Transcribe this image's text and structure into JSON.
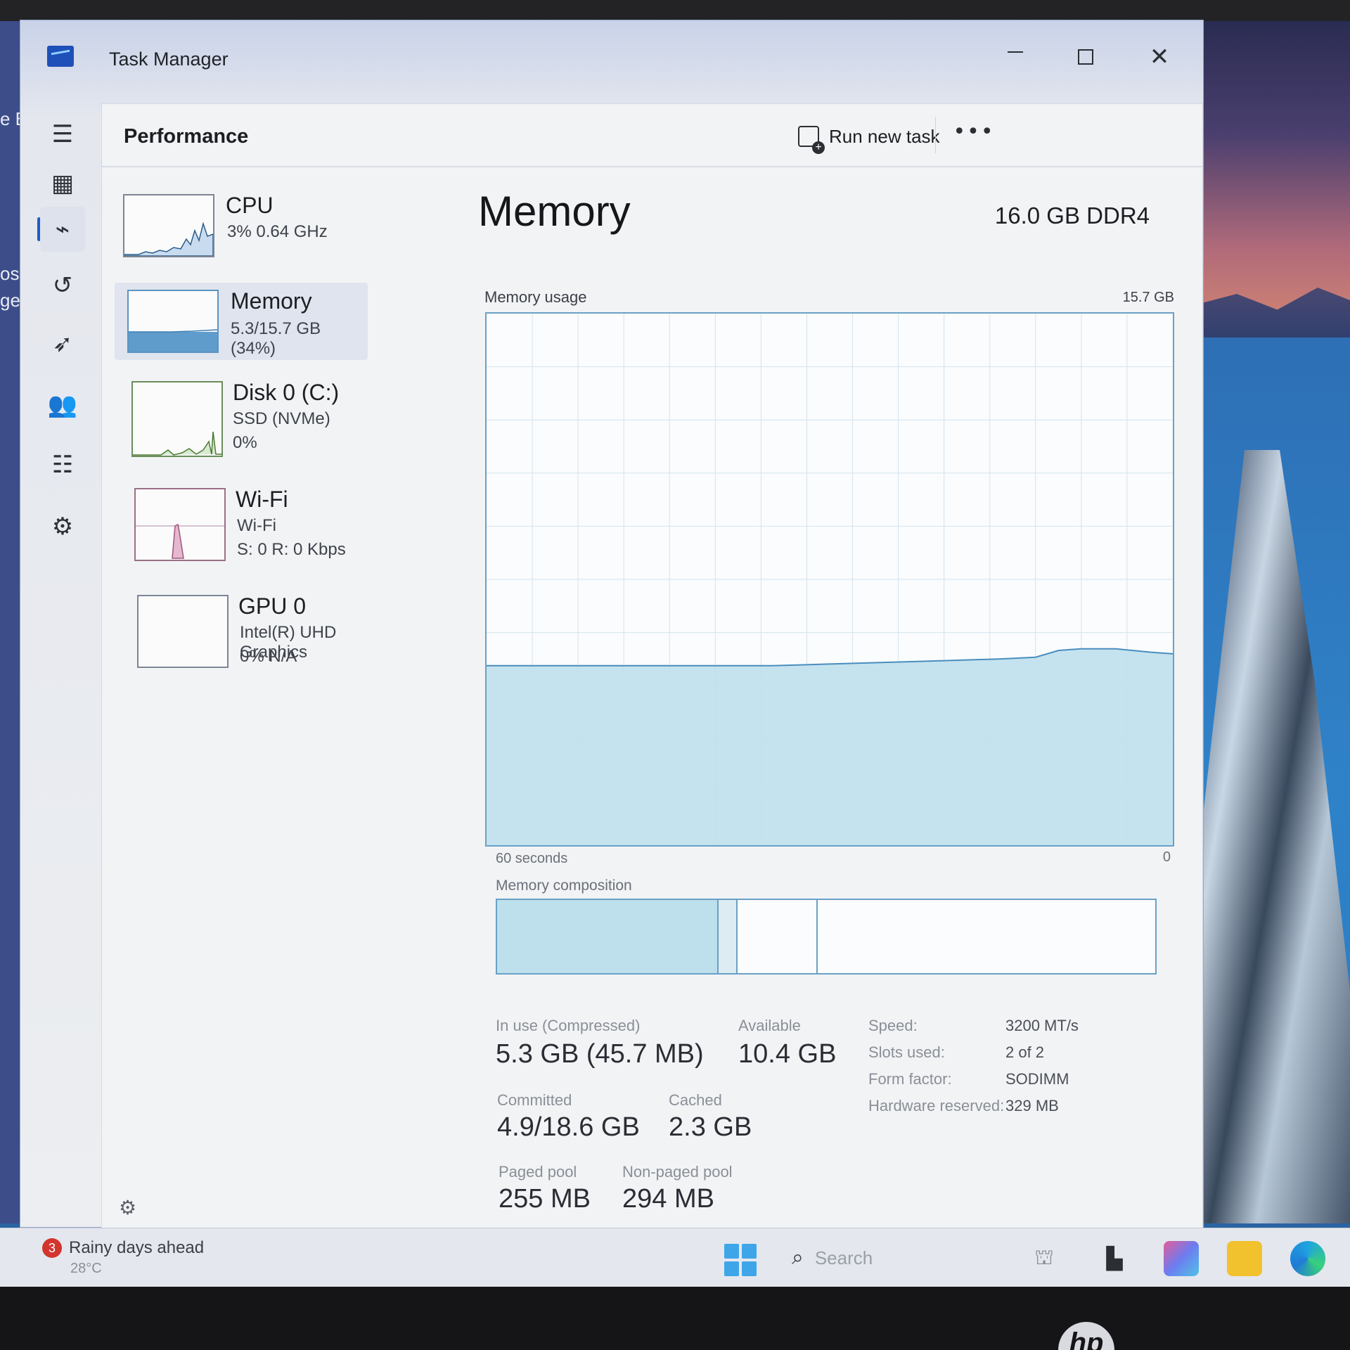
{
  "window": {
    "title": "Task Manager",
    "controls": {
      "minimize": "minimize",
      "maximize": "maximize",
      "close": "✕"
    }
  },
  "desktop": {
    "left_text_1": "e B",
    "left_text_2": "osof",
    "left_text_3": "ge"
  },
  "rail": {
    "items": [
      {
        "name": "menu-icon",
        "glyph": "☰"
      },
      {
        "name": "processes-icon",
        "glyph": "▦"
      },
      {
        "name": "performance-icon",
        "glyph": "⌁"
      },
      {
        "name": "app-history-icon",
        "glyph": "↺"
      },
      {
        "name": "startup-apps-icon",
        "glyph": "➶"
      },
      {
        "name": "users-icon",
        "glyph": "👥"
      },
      {
        "name": "details-icon",
        "glyph": "☷"
      },
      {
        "name": "services-icon",
        "glyph": "⚙"
      }
    ],
    "settings_glyph": "⚙"
  },
  "header": {
    "title": "Performance",
    "run_new_task": "Run new task",
    "more": "•••"
  },
  "sidebar": {
    "items": [
      {
        "name": "CPU",
        "line1": "3%  0.64 GHz",
        "line2": ""
      },
      {
        "name": "Memory",
        "line1": "5.3/15.7 GB (34%)",
        "line2": ""
      },
      {
        "name": "Disk 0 (C:)",
        "line1": "SSD (NVMe)",
        "line2": "0%"
      },
      {
        "name": "Wi-Fi",
        "line1": "Wi-Fi",
        "line2": "S: 0 R: 0 Kbps"
      },
      {
        "name": "GPU 0",
        "line1": "Intel(R) UHD Graphics",
        "line2": "0%  N/A"
      }
    ]
  },
  "memory": {
    "title": "Memory",
    "spec": "16.0 GB DDR4",
    "usage_label": "Memory usage",
    "usage_max": "15.7 GB",
    "axis_left": "60 seconds",
    "axis_right": "0",
    "composition_label": "Memory composition",
    "composition": {
      "in_use_fraction": 0.337,
      "modified_fraction": 0.028,
      "standby_fraction": 0.122
    },
    "stats": {
      "in_use_label": "In use (Compressed)",
      "in_use_value": "5.3 GB (45.7 MB)",
      "available_label": "Available",
      "available_value": "10.4 GB",
      "committed_label": "Committed",
      "committed_value": "4.9/18.6 GB",
      "cached_label": "Cached",
      "cached_value": "2.3 GB",
      "paged_label": "Paged pool",
      "paged_value": "255 MB",
      "nonpaged_label": "Non-paged pool",
      "nonpaged_value": "294 MB"
    },
    "specs": [
      {
        "label": "Speed:",
        "value": "3200 MT/s"
      },
      {
        "label": "Slots used:",
        "value": "2 of 2"
      },
      {
        "label": "Form factor:",
        "value": "SODIMM"
      },
      {
        "label": "Hardware reserved:",
        "value": "329 MB"
      }
    ]
  },
  "taskbar": {
    "weather_badge": "3",
    "weather_text": "Rainy days ahead",
    "weather_temp": "28°C",
    "search_placeholder": "Search"
  },
  "chart_data": {
    "type": "area",
    "title": "Memory usage",
    "xlabel": "60 seconds",
    "ylabel": "",
    "ylim": [
      0,
      15.7
    ],
    "x": [
      60,
      55,
      50,
      45,
      40,
      35,
      30,
      25,
      20,
      15,
      12,
      10,
      8,
      5,
      2,
      0
    ],
    "series": [
      {
        "values": [
          5.3,
          5.3,
          5.3,
          5.3,
          5.3,
          5.3,
          5.35,
          5.4,
          5.45,
          5.5,
          5.55,
          5.75,
          5.8,
          5.8,
          5.7,
          5.65
        ]
      }
    ]
  }
}
